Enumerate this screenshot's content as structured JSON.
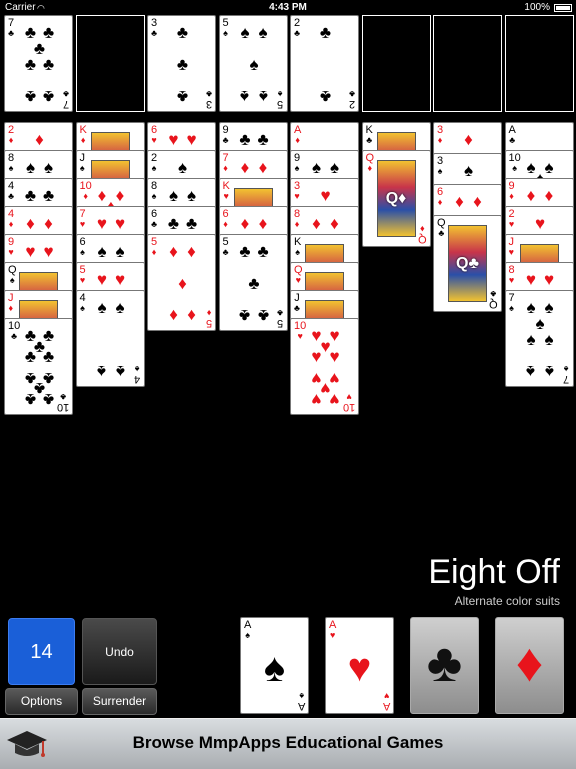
{
  "status_bar": {
    "carrier": "Carrier",
    "time": "4:43 PM",
    "battery": "100%"
  },
  "free_cells": [
    {
      "rank": "7",
      "suit": "♣",
      "color": "black"
    },
    null,
    {
      "rank": "3",
      "suit": "♣",
      "color": "black"
    },
    {
      "rank": "5",
      "suit": "♠",
      "color": "black"
    },
    {
      "rank": "2",
      "suit": "♣",
      "color": "black"
    },
    null,
    null,
    null
  ],
  "tableau": [
    [
      {
        "rank": "2",
        "suit": "♦",
        "color": "red"
      },
      {
        "rank": "8",
        "suit": "♠",
        "color": "black"
      },
      {
        "rank": "4",
        "suit": "♣",
        "color": "black"
      },
      {
        "rank": "4",
        "suit": "♦",
        "color": "red"
      },
      {
        "rank": "9",
        "suit": "♥",
        "color": "red"
      },
      {
        "rank": "Q",
        "suit": "♠",
        "color": "black"
      },
      {
        "rank": "J",
        "suit": "♦",
        "color": "red"
      },
      {
        "rank": "10",
        "suit": "♣",
        "color": "black"
      }
    ],
    [
      {
        "rank": "K",
        "suit": "♦",
        "color": "red"
      },
      {
        "rank": "J",
        "suit": "♠",
        "color": "black"
      },
      {
        "rank": "10",
        "suit": "♦",
        "color": "red"
      },
      {
        "rank": "7",
        "suit": "♥",
        "color": "red"
      },
      {
        "rank": "6",
        "suit": "♠",
        "color": "black"
      },
      {
        "rank": "5",
        "suit": "♥",
        "color": "red"
      },
      {
        "rank": "4",
        "suit": "♠",
        "color": "black"
      }
    ],
    [
      {
        "rank": "6",
        "suit": "♥",
        "color": "red"
      },
      {
        "rank": "2",
        "suit": "♠",
        "color": "black"
      },
      {
        "rank": "8",
        "suit": "♠",
        "color": "black"
      },
      {
        "rank": "6",
        "suit": "♣",
        "color": "black"
      },
      {
        "rank": "5",
        "suit": "♦",
        "color": "red"
      }
    ],
    [
      {
        "rank": "9",
        "suit": "♣",
        "color": "black"
      },
      {
        "rank": "7",
        "suit": "♦",
        "color": "red"
      },
      {
        "rank": "K",
        "suit": "♥",
        "color": "red"
      },
      {
        "rank": "6",
        "suit": "♦",
        "color": "red"
      },
      {
        "rank": "5",
        "suit": "♣",
        "color": "black"
      }
    ],
    [
      {
        "rank": "A",
        "suit": "♦",
        "color": "red"
      },
      {
        "rank": "9",
        "suit": "♠",
        "color": "black"
      },
      {
        "rank": "3",
        "suit": "♥",
        "color": "red"
      },
      {
        "rank": "8",
        "suit": "♦",
        "color": "red"
      },
      {
        "rank": "K",
        "suit": "♠",
        "color": "black"
      },
      {
        "rank": "Q",
        "suit": "♥",
        "color": "red"
      },
      {
        "rank": "J",
        "suit": "♣",
        "color": "black"
      },
      {
        "rank": "10",
        "suit": "♥",
        "color": "red"
      }
    ],
    [
      {
        "rank": "K",
        "suit": "♣",
        "color": "black"
      },
      {
        "rank": "Q",
        "suit": "♦",
        "color": "red"
      }
    ],
    [
      {
        "rank": "3",
        "suit": "♦",
        "color": "red"
      },
      {
        "rank": "3",
        "suit": "♠",
        "color": "black"
      },
      {
        "rank": "6",
        "suit": "♦",
        "color": "red"
      },
      {
        "rank": "Q",
        "suit": "♣",
        "color": "black"
      }
    ],
    [
      {
        "rank": "A",
        "suit": "♣",
        "color": "black"
      },
      {
        "rank": "10",
        "suit": "♠",
        "color": "black"
      },
      {
        "rank": "9",
        "suit": "♦",
        "color": "red"
      },
      {
        "rank": "2",
        "suit": "♥",
        "color": "red"
      },
      {
        "rank": "J",
        "suit": "♥",
        "color": "red"
      },
      {
        "rank": "8",
        "suit": "♥",
        "color": "red"
      },
      {
        "rank": "7",
        "suit": "♠",
        "color": "black"
      }
    ]
  ],
  "game": {
    "title": "Eight Off",
    "subtitle": "Alternate color suits"
  },
  "controls": {
    "score": "14",
    "undo": "Undo",
    "options": "Options",
    "surrender": "Surrender"
  },
  "foundations": [
    {
      "rank": "A",
      "suit": "♠",
      "color": "black"
    },
    {
      "rank": "A",
      "suit": "♥",
      "color": "red"
    },
    {
      "empty": true,
      "suit": "♣",
      "color": "black",
      "icon": "club-icon"
    },
    {
      "empty": true,
      "suit": "♦",
      "color": "red",
      "icon": "diamond-icon"
    }
  ],
  "ad": {
    "text": "Browse MmpApps Educational Games",
    "icon": "graduation-cap-icon"
  }
}
